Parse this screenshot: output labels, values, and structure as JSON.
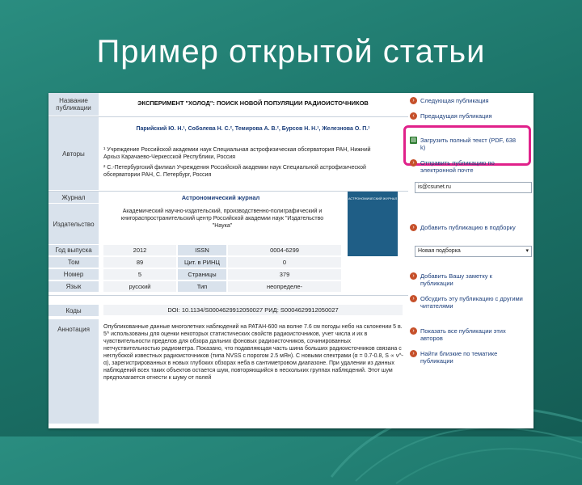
{
  "slide": {
    "title": "Пример открытой статьи"
  },
  "article": {
    "labels": {
      "pub_name": "Название публикации",
      "authors": "Авторы",
      "journal": "Журнал",
      "publisher": "Издательство",
      "year": "Год выпуска",
      "volume": "Том",
      "number": "Номер",
      "language": "Язык",
      "codes": "Коды",
      "abstract": "Аннотация"
    },
    "title": "ЭКСПЕРИМЕНТ \"ХОЛОД\": ПОИСК НОВОЙ ПОПУЛЯЦИИ РАДИОИСТОЧНИКОВ",
    "authors_line": "Парийский Ю. Н.¹, Соболева Н. С.², Темирова А. В.², Бурсов Н. Н.¹, Железнова О. П.¹",
    "affiliation_1": "¹ Учреждение Российской академии наук Специальная астрофизическая обсерватория РАН, Нижний Архыз Карачаево-Черкесской Республики, Россия",
    "affiliation_2": "² С.-Петербургский филиал Учреждения Российской академии наук Специальной астрофизической обсерватории РАН, С. Петербург, Россия",
    "journal": "Астрономический журнал",
    "publisher": "Академический научно-издательский, производственно-полиграфический и книгораспространительский центр Российской академии наук \"Издательство \"Наука\"",
    "cover_text": "АСТРОНОМИЧЕСКИЙ ЖУРНАЛ",
    "rows": [
      {
        "v1": "2012",
        "k2": "ISSN",
        "v2": "0004-6299"
      },
      {
        "v1": "89",
        "k2": "Цит. в РИНЦ",
        "v2": "0"
      },
      {
        "v1": "5",
        "k2": "Страницы",
        "v2": "379"
      },
      {
        "v1": "русский",
        "k2": "Тип",
        "v2": "неопределе-"
      }
    ],
    "codes": "DOI: 10.1134/S0004629912050027     РИД: S0004629912050027",
    "abstract": "Опубликованные данные многолетних наблюдений на РАТАН-600 на волне 7.6 см погоды небо на склонении 5 в. 5^ использованы для оценки некоторых статистических свойств радиоисточников, учет числа и их в чувствительности пределов для обзора дальних фоновых радиоисточников, сочинированных нетчуствительностью радиометра. Показано, что подавляющая часть шина больших радиоисточников связана с неглубокой известных радиоисточников (типа NVSS с порогом 2.5 мЯн). С новыми спектрами (α = 0.7-0.8, S ∝ ν^-α), зарегистрированных в новых глубоких обзорах неба в сантиметровом диапазоне. При удалении из данных наблюдений всех таких объектов остается шум, повторяющийся в нескольких группах наблюдений. Этот шум предполагается отнести к шуму от полей"
  },
  "sidebar": {
    "items": [
      {
        "label": "Следующая публикация"
      },
      {
        "label": "Предыдущая публикация"
      },
      {
        "label": "Загрузить полный текст (PDF, 638 k)"
      },
      {
        "label": "Отправить публикацию по электронной почте"
      },
      {
        "label": "Добавить публикацию в подборку"
      },
      {
        "label": "Добавить Вашу заметку к публикации"
      },
      {
        "label": "Обсудить эту публикацию с другими читателями"
      },
      {
        "label": "Показать все публикации этих авторов"
      },
      {
        "label": "Найти близкие по тематике публикации"
      }
    ],
    "email_value": "is@csunet.ru",
    "collection_value": "Новая подборка"
  },
  "colors": {
    "background": "#1d7a70",
    "highlight": "#e0218a",
    "label_bg": "#d9e2ec",
    "link": "#1a3d7a"
  }
}
